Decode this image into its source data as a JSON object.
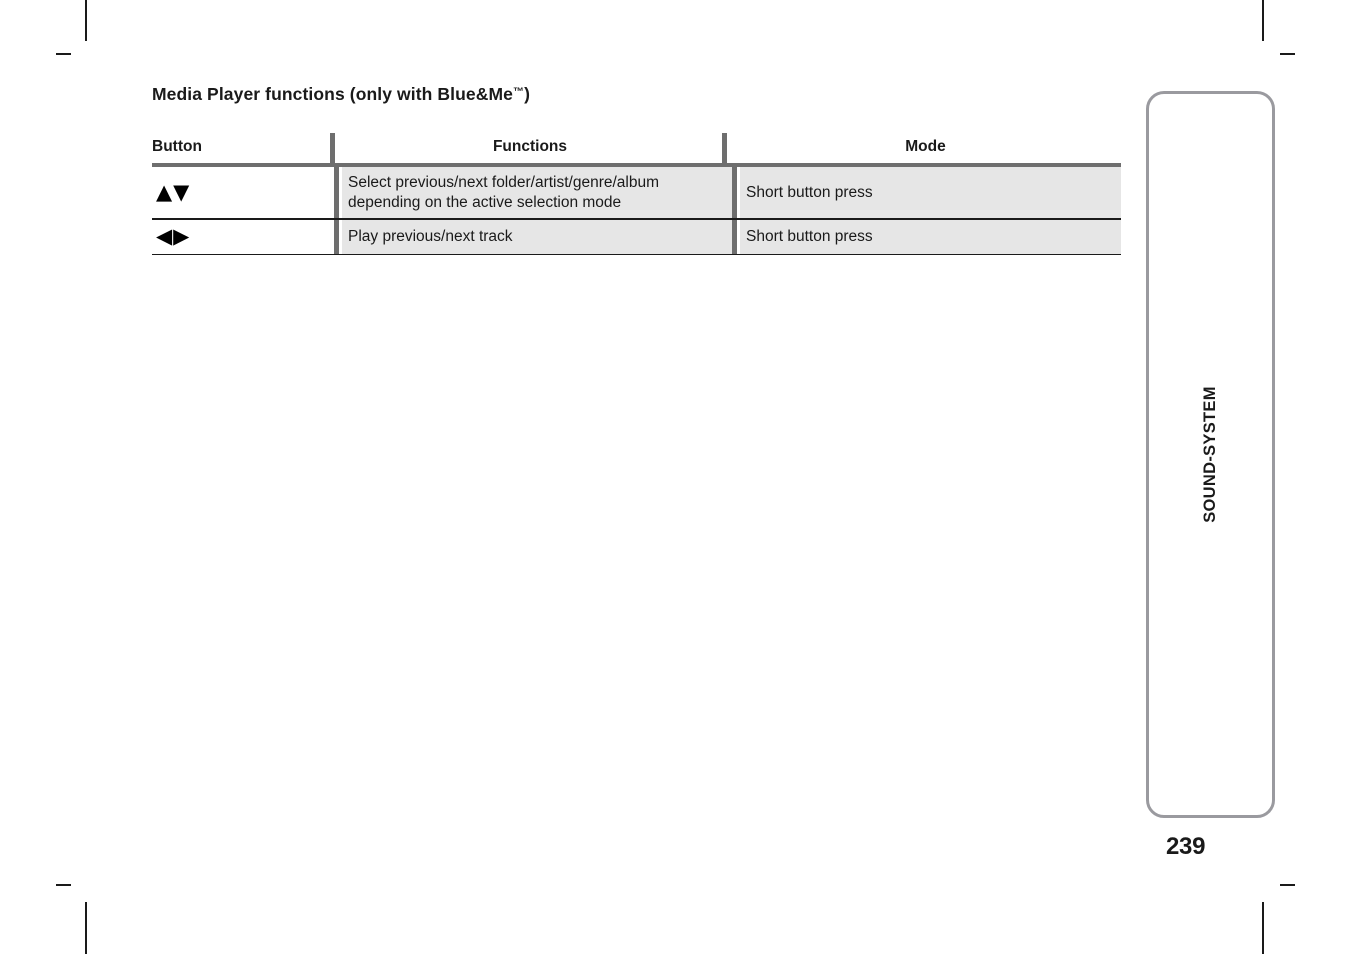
{
  "document": {
    "section_title": "Media Player functions (only with Blue&Me",
    "section_title_tm": "™",
    "section_title_close": ")",
    "page_number": "239",
    "side_tab_label": "SOUND-SYSTEM"
  },
  "table": {
    "headers": {
      "button": "Button",
      "functions": "Functions",
      "mode": "Mode"
    },
    "rows": [
      {
        "button_icons": "▲▼",
        "button_icon_names": [
          "triangle-up-icon",
          "triangle-down-icon"
        ],
        "function_line_1": "Select previous/next folder/artist/genre/album",
        "function_line_2": "depending on the active selection mode",
        "mode": "Short button press"
      },
      {
        "button_icons": "◀▶",
        "button_icon_names": [
          "triangle-left-icon",
          "triangle-right-icon"
        ],
        "function_line_1": "Play previous/next track",
        "function_line_2": "",
        "mode": "Short button press"
      }
    ]
  },
  "colors": {
    "cell_fill": "#e6e6e6",
    "rule_gray": "#6e6e6e",
    "rule_black": "#1a1a1a",
    "side_box_border": "#9a9a9f",
    "page_background": "#ffffff"
  }
}
